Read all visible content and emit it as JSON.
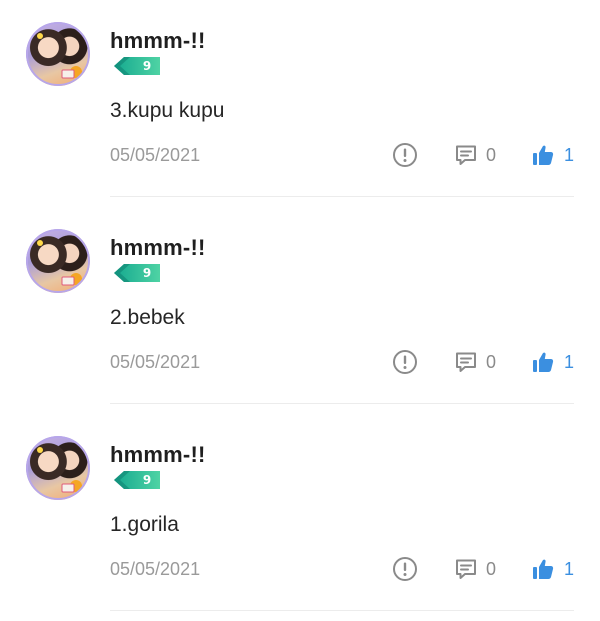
{
  "comments": [
    {
      "username": "hmmm-!!",
      "level": "9",
      "text": "3.kupu kupu",
      "date": "05/05/2021",
      "reply_count": "0",
      "like_count": "1",
      "icons": {
        "report": "alert-circle-icon",
        "reply": "comment-icon",
        "like": "thumbs-up-icon"
      }
    },
    {
      "username": "hmmm-!!",
      "level": "9",
      "text": "2.bebek",
      "date": "05/05/2021",
      "reply_count": "0",
      "like_count": "1",
      "icons": {
        "report": "alert-circle-icon",
        "reply": "comment-icon",
        "like": "thumbs-up-icon"
      }
    },
    {
      "username": "hmmm-!!",
      "level": "9",
      "text": "1.gorila",
      "date": "05/05/2021",
      "reply_count": "0",
      "like_count": "1",
      "icons": {
        "report": "alert-circle-icon",
        "reply": "comment-icon",
        "like": "thumbs-up-icon"
      }
    }
  ],
  "colors": {
    "like_accent": "#3b8fe0",
    "badge_start": "#1fb8a3",
    "badge_end": "#45d0a2",
    "muted_text": "#9a9a9a",
    "icon_gray": "#8a8a8a"
  }
}
